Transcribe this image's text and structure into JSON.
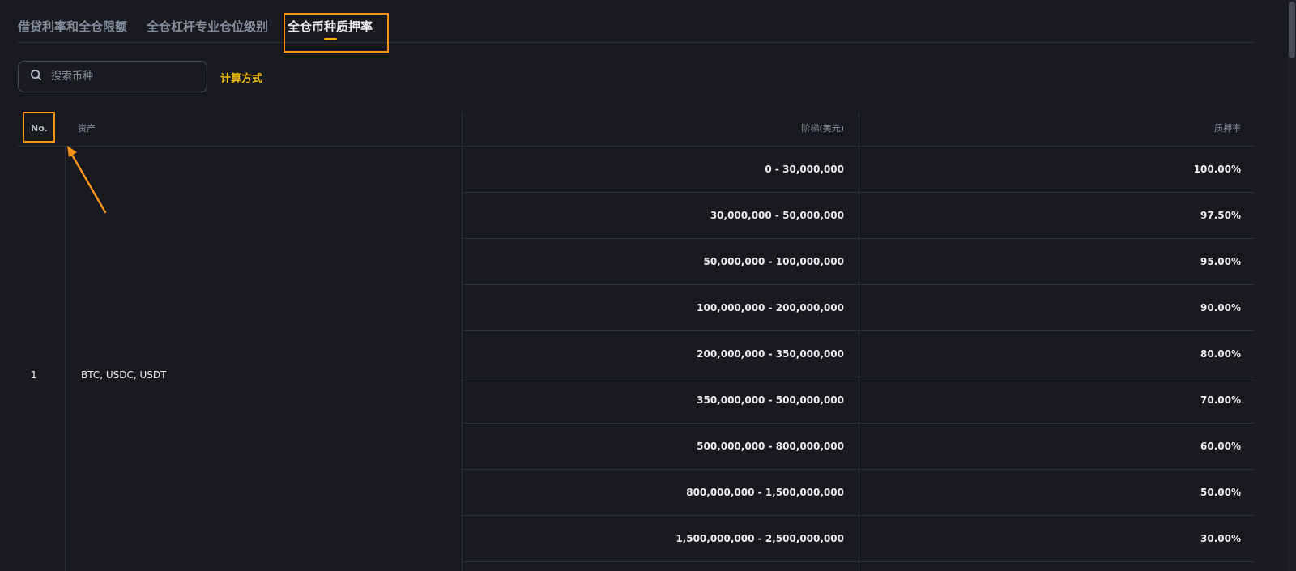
{
  "tabs": [
    {
      "label": "借贷利率和全仓限额"
    },
    {
      "label": "全仓杠杆专业仓位级别"
    },
    {
      "label": "全仓币种质押率"
    }
  ],
  "active_tab": 2,
  "search": {
    "placeholder": "搜索币种",
    "value": ""
  },
  "calc_link": "计算方式",
  "table": {
    "headers": {
      "no": "No.",
      "asset": "资产",
      "tier": "阶梯(美元)",
      "rate": "质押率"
    },
    "rows": [
      {
        "no": "1",
        "asset": "BTC, USDC, USDT",
        "tiers": [
          {
            "range": "0 - 30,000,000",
            "rate": "100.00%"
          },
          {
            "range": "30,000,000 - 50,000,000",
            "rate": "97.50%"
          },
          {
            "range": "50,000,000 - 100,000,000",
            "rate": "95.00%"
          },
          {
            "range": "100,000,000 - 200,000,000",
            "rate": "90.00%"
          },
          {
            "range": "200,000,000 - 350,000,000",
            "rate": "80.00%"
          },
          {
            "range": "350,000,000 - 500,000,000",
            "rate": "70.00%"
          },
          {
            "range": "500,000,000 - 800,000,000",
            "rate": "60.00%"
          },
          {
            "range": "800,000,000 - 1,500,000,000",
            "rate": "50.00%"
          },
          {
            "range": "1,500,000,000 - 2,500,000,000",
            "rate": "30.00%"
          }
        ]
      }
    ]
  },
  "colors": {
    "accent": "#f0b90b",
    "highlight": "#f7931a",
    "background": "#181a20"
  }
}
